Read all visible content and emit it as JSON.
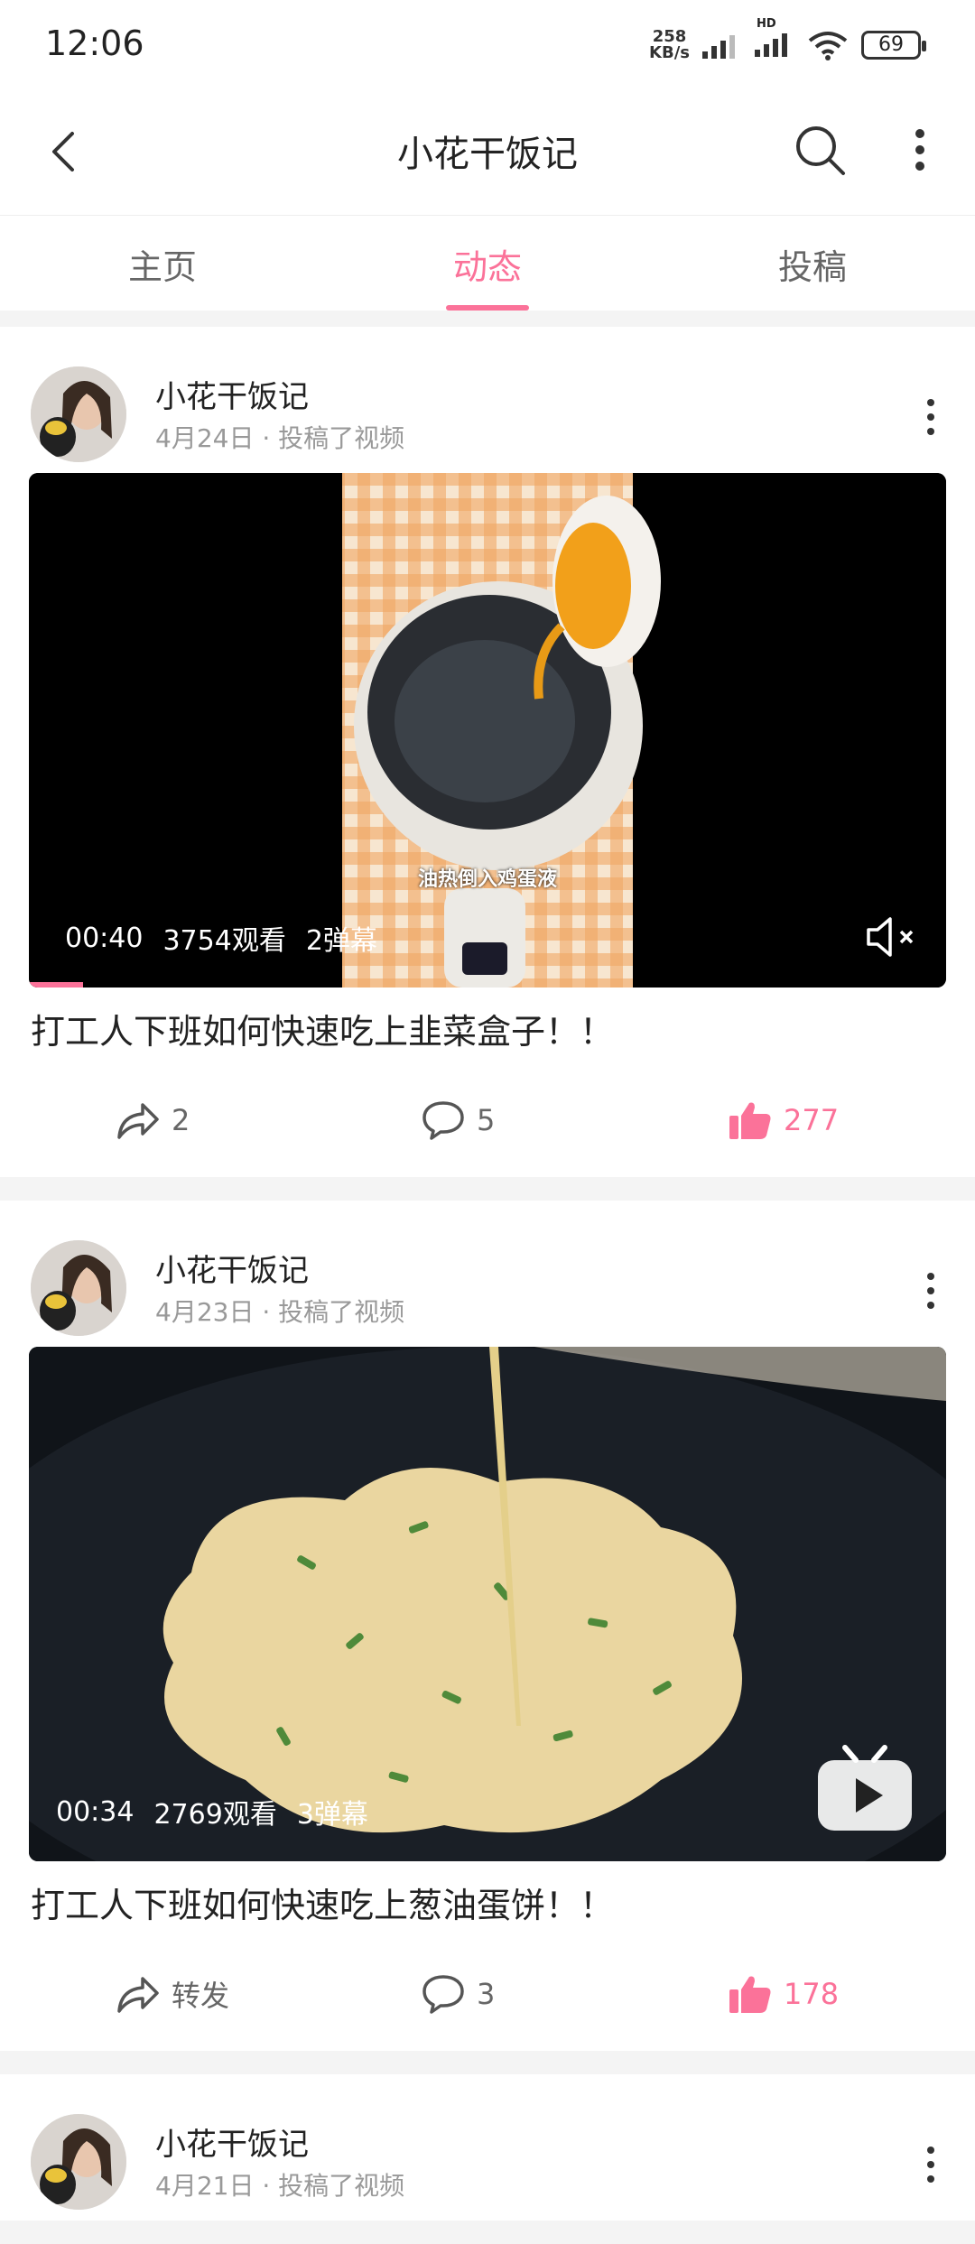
{
  "status": {
    "time": "12:06",
    "net_speed_value": "258",
    "net_speed_unit": "KB/s",
    "network_label": "HD",
    "battery": "69"
  },
  "header": {
    "title": "小花干饭记"
  },
  "tabs": [
    {
      "label": "主页",
      "active": false
    },
    {
      "label": "动态",
      "active": true
    },
    {
      "label": "投稿",
      "active": false
    }
  ],
  "posts": [
    {
      "author": "小花干饭记",
      "meta": "4月24日 · 投稿了视频",
      "duration": "00:40",
      "views": "3754观看",
      "danmaku": "2弹幕",
      "subtitle": "油热倒入鸡蛋液",
      "title": "打工人下班如何快速吃上韭菜盒子！！",
      "share": "2",
      "comments": "5",
      "likes": "277"
    },
    {
      "author": "小花干饭记",
      "meta": "4月23日 · 投稿了视频",
      "duration": "00:34",
      "views": "2769观看",
      "danmaku": "3弹幕",
      "title": "打工人下班如何快速吃上葱油蛋饼！！",
      "share": "转发",
      "comments": "3",
      "likes": "178"
    },
    {
      "author": "小花干饭记",
      "meta": "4月21日 · 投稿了视频"
    }
  ],
  "colors": {
    "accent": "#fb7299",
    "text": "#222222",
    "muted": "#999999"
  }
}
